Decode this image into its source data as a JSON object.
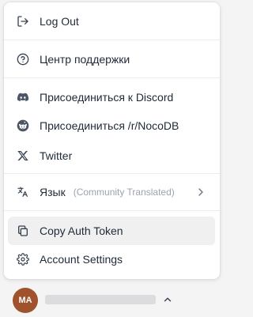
{
  "menu": {
    "logout": {
      "label": "Log Out",
      "icon": "logout-icon"
    },
    "support": {
      "label": "Центр поддержки",
      "icon": "help-circle-icon"
    },
    "discord": {
      "label": "Присоединиться к Discord",
      "icon": "discord-icon"
    },
    "reddit": {
      "label": "Присоединиться /r/NocoDB",
      "icon": "reddit-icon"
    },
    "twitter": {
      "label": "Twitter",
      "icon": "x-twitter-icon"
    },
    "language": {
      "label": "Язык",
      "sublabel": "(Community Translated)",
      "icon": "translate-icon"
    },
    "copy_token": {
      "label": "Copy Auth Token",
      "icon": "copy-icon"
    },
    "account_settings": {
      "label": "Account Settings",
      "icon": "gear-icon"
    }
  },
  "footer": {
    "avatar_initials": "MA"
  },
  "colors": {
    "avatar": "#a0522d",
    "hover_bg": "#f0f0f1",
    "text": "#1f2937",
    "muted": "#9ca3af"
  }
}
